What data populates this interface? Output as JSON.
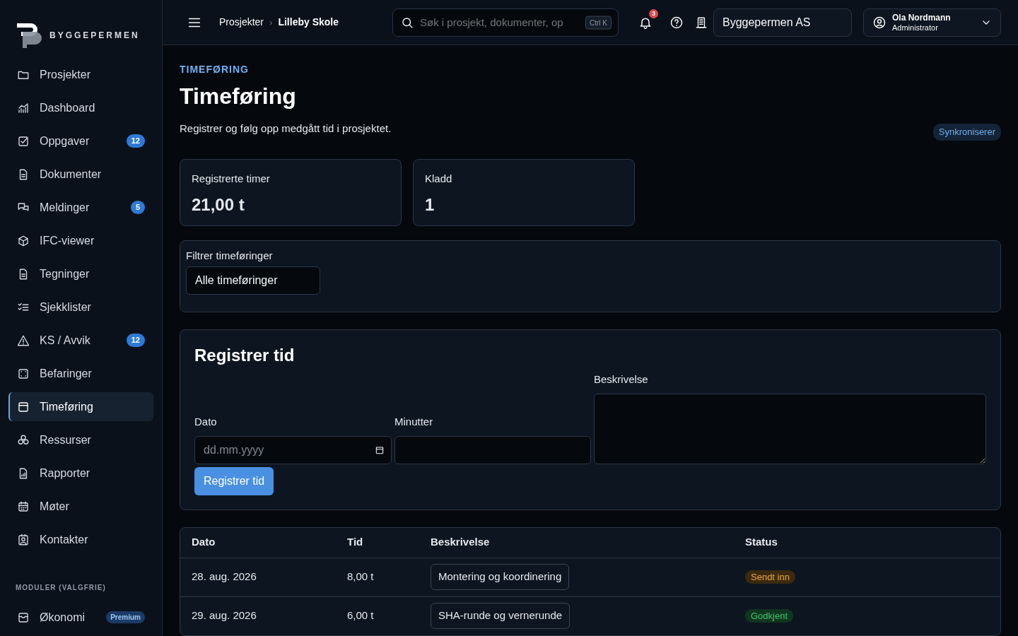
{
  "brand": "BYGGEPERMEN",
  "sidebar": {
    "items": [
      {
        "label": "Prosjekter",
        "selected": false
      },
      {
        "label": "Dashboard",
        "selected": false
      },
      {
        "label": "Oppgaver",
        "selected": false,
        "badge": "12"
      },
      {
        "label": "Dokumenter",
        "selected": false
      },
      {
        "label": "Meldinger",
        "selected": false,
        "badge": "5"
      },
      {
        "label": "IFC-viewer",
        "selected": false
      },
      {
        "label": "Tegninger",
        "selected": false
      },
      {
        "label": "Sjekklister",
        "selected": false
      },
      {
        "label": "KS / Avvik",
        "selected": false,
        "badge": "12"
      },
      {
        "label": "Befaringer",
        "selected": false
      },
      {
        "label": "Timeføring",
        "selected": true
      },
      {
        "label": "Ressurser",
        "selected": false
      },
      {
        "label": "Rapporter",
        "selected": false
      },
      {
        "label": "Møter",
        "selected": false
      },
      {
        "label": "Kontakter",
        "selected": false
      }
    ],
    "section_title": "MODULER (VALGFRIE)",
    "module_items": [
      {
        "label": "Økonomi",
        "selected": false,
        "badge": "Premium"
      }
    ]
  },
  "topbar": {
    "breadcrumb": [
      "Prosjekter",
      "Lilleby Skole"
    ],
    "breadcrumb_separator": "›",
    "search": {
      "placeholder": "Søk i prosjekt, dokumenter, op",
      "shortcut": "Ctrl K"
    },
    "notifications": "3",
    "company": "Byggepermen AS",
    "user": {
      "name": "Ola Nordmann",
      "role": "Administrator"
    }
  },
  "page": {
    "eyebrow": "TIMEFØRING",
    "title": "Timeføring",
    "subtitle": "Registrer og følg opp medgått tid i prosjektet.",
    "sync_badge": "Synkroniserer"
  },
  "stats": [
    {
      "label": "Registrerte timer",
      "value": "21,00 t"
    },
    {
      "label": "Kladd",
      "value": "1"
    }
  ],
  "filter": {
    "label": "Filtrer timeføringer",
    "value": "Alle timeføringer"
  },
  "form": {
    "title": "Registrer tid",
    "date_label": "Dato",
    "date_placeholder": "dd.mm.yyyy",
    "minutes_label": "Minutter",
    "description_label": "Beskrivelse",
    "submit": "Registrer tid"
  },
  "table": {
    "columns": [
      "Dato",
      "Tid",
      "Beskrivelse",
      "Status"
    ],
    "rows": [
      {
        "date": "28. aug. 2026",
        "time": "8,00 t",
        "description": "Montering og koordinering",
        "status": {
          "label": "Sendt inn",
          "kind": "submitted"
        }
      },
      {
        "date": "29. aug. 2026",
        "time": "6,00 t",
        "description": "SHA-runde og vernerunde",
        "status": {
          "label": "Godkjent",
          "kind": "approved"
        }
      }
    ]
  }
}
